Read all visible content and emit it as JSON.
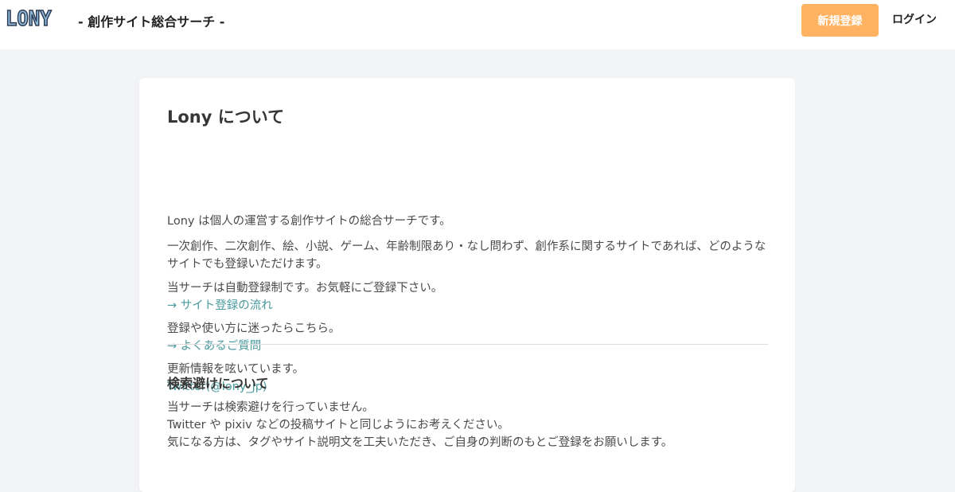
{
  "header": {
    "logo": "LONY",
    "subtitle": "- 創作サイト総合サーチ -",
    "register_label": "新規登録",
    "login_label": "ログイン"
  },
  "about": {
    "title": "Lony について",
    "intro": "Lony は個人の運営する創作サイトの総合サーチです。",
    "genres": "一次創作、二次創作、絵、小説、ゲーム、年齢制限あり・なし問わず、創作系に関するサイトであれば、どのようなサイトでも登録いただけます。",
    "auto_register": "当サーチは自動登録制です。お気軽にご登録下さい。",
    "flow_link": "→ サイト登録の流れ",
    "help_text": "登録や使い方に迷ったらこちら。",
    "faq_link": "→ よくあるご質問",
    "updates_text": "更新情報を呟いています。",
    "twitter_link": "Twitter(@lony_jp)"
  },
  "search_avoid": {
    "title": "検索避けについて",
    "line1": "当サーチは検索避けを行っていません。",
    "line2": "Twitter や pixiv などの投稿サイトと同じようにお考えください。",
    "line3": "気になる方は、タグやサイト説明文を工夫いただき、ご自身の判断のもとご登録をお願いします。"
  },
  "colors": {
    "register_button": "#ffb261",
    "link": "#4a9a9c",
    "background": "#f2f3f5"
  }
}
